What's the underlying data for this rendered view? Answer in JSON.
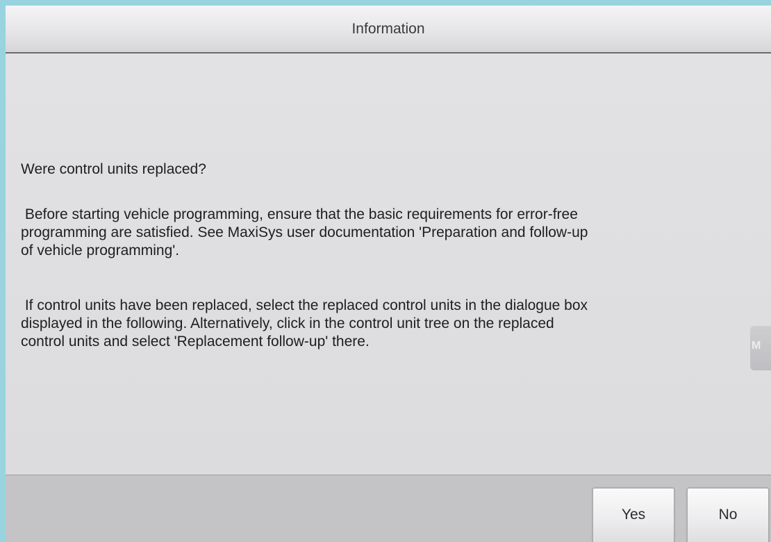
{
  "dialog": {
    "title": "Information",
    "question": "Were control units replaced?",
    "paragraph1": " Before starting vehicle programming, ensure that the basic requirements for error-free\nprogramming are satisfied. See MaxiSys user documentation 'Preparation and follow-up\nof vehicle programming'.",
    "paragraph2": " If control units have been replaced, select the replaced control units in the dialogue box\ndisplayed in the following. Alternatively, click in the control unit tree on the replaced\ncontrol units and select 'Replacement follow-up' there.",
    "side_badge_text": "M"
  },
  "buttons": {
    "yes_label": "Yes",
    "no_label": "No"
  }
}
